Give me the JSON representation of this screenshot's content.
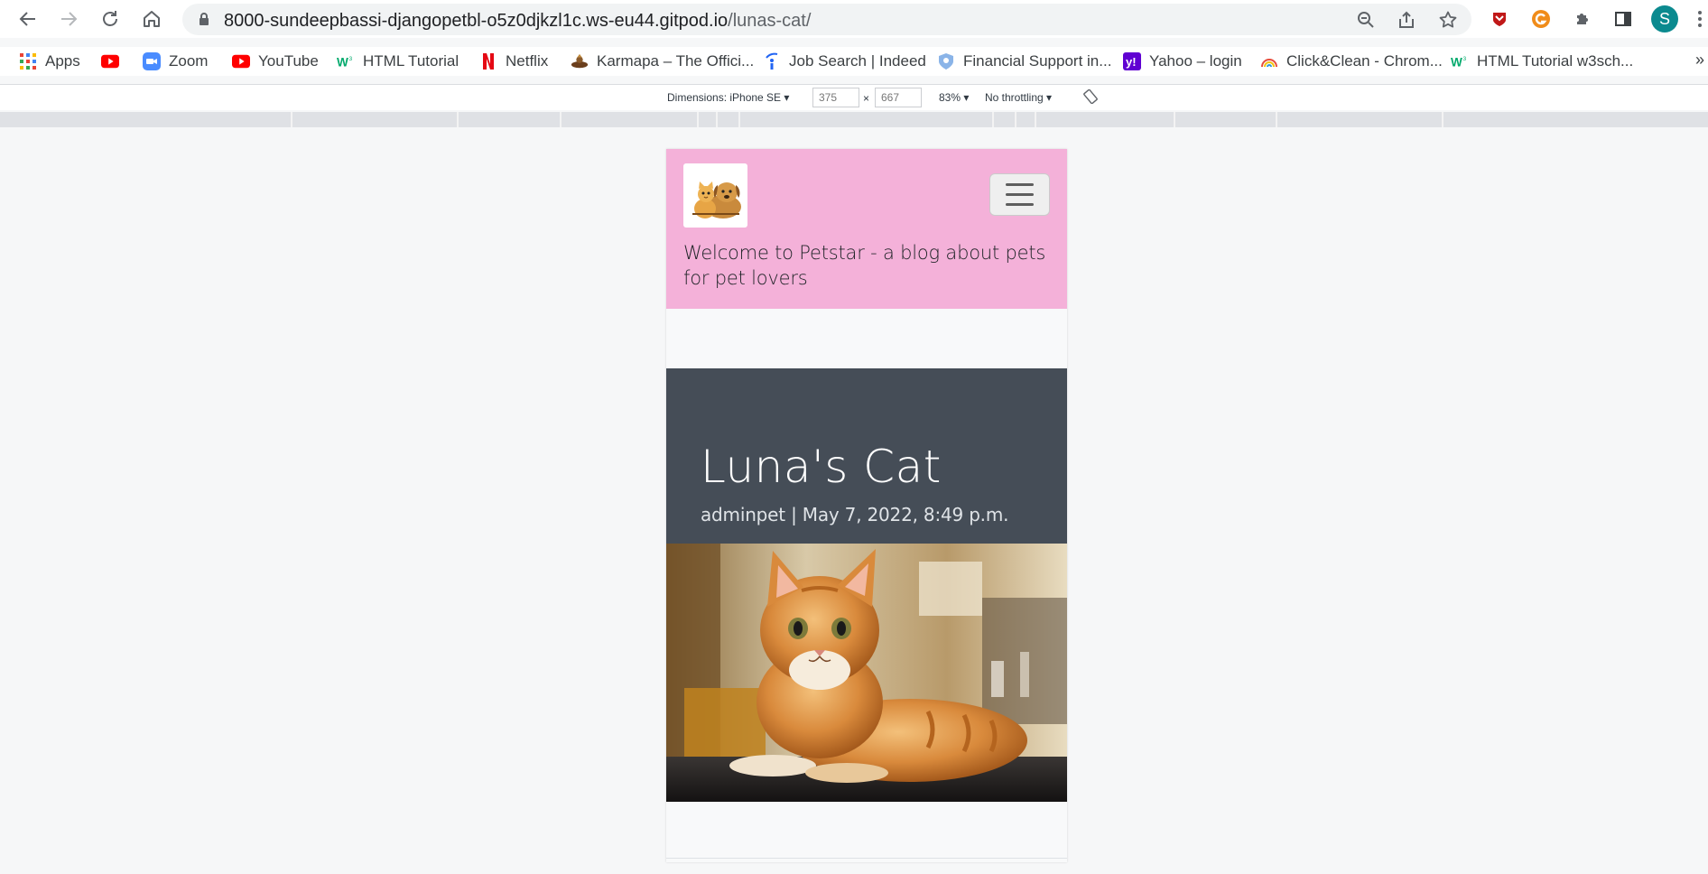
{
  "browser": {
    "url_host": "8000-sundeepbassi-djangopetbl-o5z0djkzl1c.ws-eu44.gitpod.io",
    "url_path": "/lunas-cat/",
    "profile_initial": "S"
  },
  "bookmarks": [
    {
      "label": "Apps",
      "icon": "apps-grid-icon"
    },
    {
      "label": "",
      "icon": "youtube-icon"
    },
    {
      "label": "Zoom",
      "icon": "zoom-icon"
    },
    {
      "label": "YouTube",
      "icon": "youtube-icon"
    },
    {
      "label": "HTML Tutorial",
      "icon": "w3schools-icon"
    },
    {
      "label": "Netflix",
      "icon": "netflix-icon"
    },
    {
      "label": "Karmapa – The Offici...",
      "icon": "karmapa-icon"
    },
    {
      "label": "Job Search | Indeed",
      "icon": "indeed-icon"
    },
    {
      "label": "Financial Support in...",
      "icon": "shield-icon"
    },
    {
      "label": "Yahoo – login",
      "icon": "yahoo-icon"
    },
    {
      "label": "Click&Clean - Chrom...",
      "icon": "rainbow-icon"
    },
    {
      "label": "HTML Tutorial w3sch...",
      "icon": "w3schools-icon"
    }
  ],
  "bookmarks_overflow": "»",
  "devtools": {
    "dimensions_label": "Dimensions: iPhone SE",
    "width": "375",
    "height": "667",
    "times": "×",
    "zoom": "83%",
    "throttling": "No throttling"
  },
  "site": {
    "tagline": "Welcome to Petstar - a blog about pets for pet lovers",
    "post_title": "Luna's Cat",
    "post_meta": "adminpet | May 7, 2022, 8:49 p.m."
  },
  "colors": {
    "navbar": "#f4b1d9",
    "masthead": "#454d57",
    "page_bg": "#f8f9fa"
  }
}
